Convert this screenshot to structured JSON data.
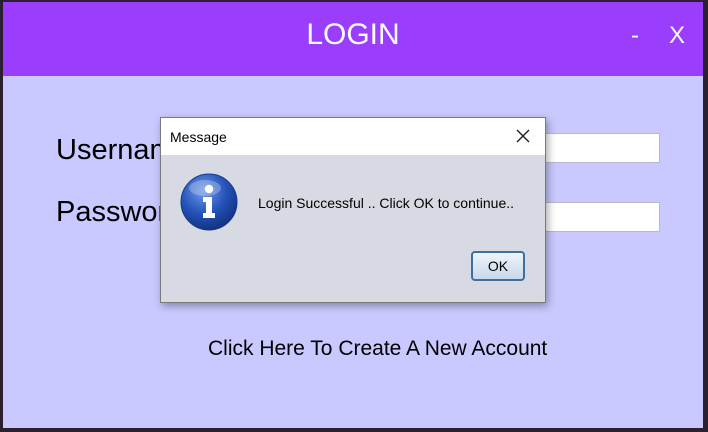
{
  "window": {
    "title": "LOGIN",
    "minimize_label": "-",
    "close_label": "X",
    "accent_color": "#9b3dfd",
    "background_color": "#cac9ff"
  },
  "form": {
    "username_label": "Username",
    "password_label": "Password",
    "username_value": "",
    "password_value": "",
    "create_account_link": "Click Here To Create A New Account"
  },
  "dialog": {
    "title": "Message",
    "icon": "info-icon",
    "message": "Login Successful .. Click OK to continue..",
    "ok_label": "OK",
    "close_icon": "close-icon"
  }
}
